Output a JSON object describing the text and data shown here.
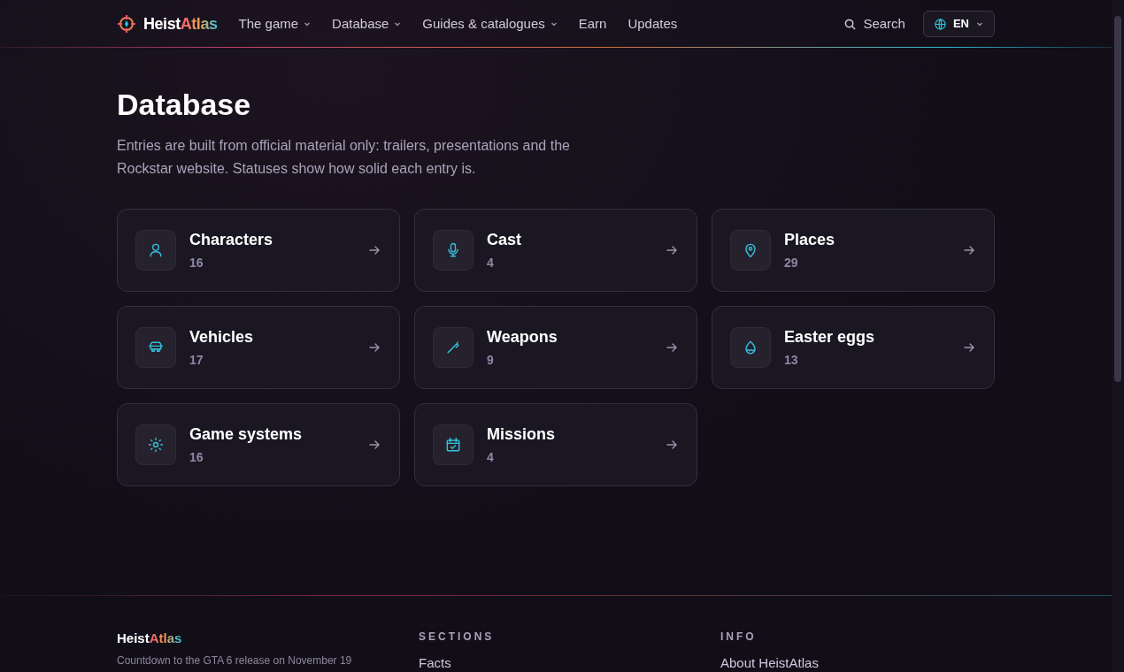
{
  "logo": {
    "first": "Heist",
    "second": "Atlas"
  },
  "nav": [
    {
      "label": "The game",
      "dropdown": true
    },
    {
      "label": "Database",
      "dropdown": true
    },
    {
      "label": "Guides & catalogues",
      "dropdown": true
    },
    {
      "label": "Earn",
      "dropdown": false
    },
    {
      "label": "Updates",
      "dropdown": false
    }
  ],
  "search": {
    "label": "Search"
  },
  "language": {
    "label": "EN"
  },
  "page": {
    "title": "Database",
    "intro": "Entries are built from official material only: trailers, presentations and the Rockstar website. Statuses show how solid each entry is."
  },
  "categories": [
    {
      "kind": "person",
      "title": "Characters",
      "count": "16"
    },
    {
      "kind": "mic",
      "title": "Cast",
      "count": "4"
    },
    {
      "kind": "pin",
      "title": "Places",
      "count": "29"
    },
    {
      "kind": "car",
      "title": "Vehicles",
      "count": "17"
    },
    {
      "kind": "weapon",
      "title": "Weapons",
      "count": "9"
    },
    {
      "kind": "egg",
      "title": "Easter eggs",
      "count": "13"
    },
    {
      "kind": "sun",
      "title": "Game systems",
      "count": "16"
    },
    {
      "kind": "calendar",
      "title": "Missions",
      "count": "4"
    }
  ],
  "footer": {
    "logo": {
      "first": "Heist",
      "second": "Atlas"
    },
    "tagline": "Countdown to the GTA 6 release on November 19",
    "columns": [
      {
        "heading": "SECTIONS",
        "links": [
          "Facts"
        ]
      },
      {
        "heading": "INFO",
        "links": [
          "About HeistAtlas"
        ]
      }
    ]
  }
}
